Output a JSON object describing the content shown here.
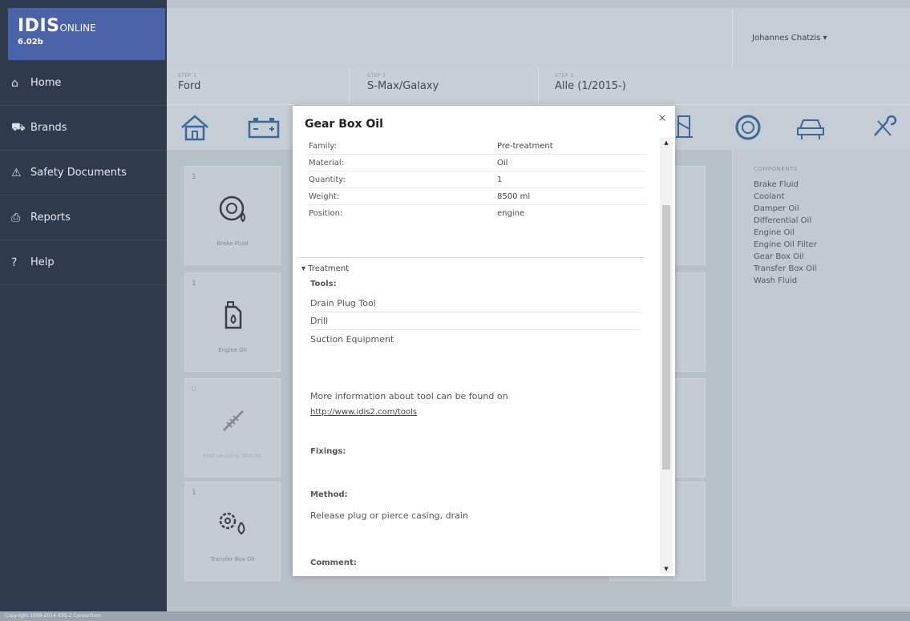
{
  "sidebar": {
    "logo_name": "IDIS",
    "logo_suffix": "ONLINE",
    "version": "6.02b",
    "items": [
      {
        "label": "Home",
        "icon": "house-icon"
      },
      {
        "label": "Brands",
        "icon": "car-icon"
      },
      {
        "label": "Safety Documents",
        "icon": "warning-icon"
      },
      {
        "label": "Reports",
        "icon": "printer-icon"
      },
      {
        "label": "Help",
        "icon": "help-icon"
      }
    ]
  },
  "topbar": {
    "user": "Johannes Chatzis ▾"
  },
  "steps": [
    {
      "label": "STEP 1",
      "value": "Ford"
    },
    {
      "label": "STEP 2",
      "value": "S-Max/Galaxy"
    },
    {
      "label": "STEP 3",
      "value": "Alle (1/2015-)"
    }
  ],
  "cards": [
    {
      "count": "1",
      "label": "Brake Fluid",
      "icon": "brake-disc-icon"
    },
    {
      "count": "1",
      "label": "Engine Oil",
      "icon": "oil-can-icon"
    },
    {
      "count": "0",
      "label": "Hall Leveling Shocks",
      "icon": "shock-absorber-icon"
    },
    {
      "count": "1",
      "label": "Transfer Box Oil",
      "icon": "gear-oil-icon"
    }
  ],
  "components": {
    "heading": "COMPONENTS",
    "items": [
      "Brake Fluid",
      "Coolant",
      "Damper Oil",
      "Differential Oil",
      "Engine Oil",
      "Engine Oil Filter",
      "Gear Box Oil",
      "Transfer Box Oil",
      "Wash Fluid"
    ]
  },
  "modal": {
    "title": "Gear Box Oil",
    "close": "×",
    "properties": [
      {
        "key": "Family:",
        "value": "Pre-treatment"
      },
      {
        "key": "Material:",
        "value": "Oil"
      },
      {
        "key": "Quantity:",
        "value": "1"
      },
      {
        "key": "Weight:",
        "value": "8500 ml"
      },
      {
        "key": "Position:",
        "value": "engine"
      }
    ],
    "treatment_heading": "▾ Treatment",
    "tools_label": "Tools:",
    "tools": [
      "Drain Plug Tool",
      "Drill",
      "Suction Equipment"
    ],
    "more_info": "More information about tool can be found on",
    "link": "http://www.idis2.com/tools",
    "fixings_label": "Fixings:",
    "method_label": "Method:",
    "method_text": "Release plug or pierce casing, drain",
    "comment_label": "Comment:"
  },
  "footer": {
    "copyright": "Copyright 1999-2014 IDIS 2 Consortium"
  }
}
